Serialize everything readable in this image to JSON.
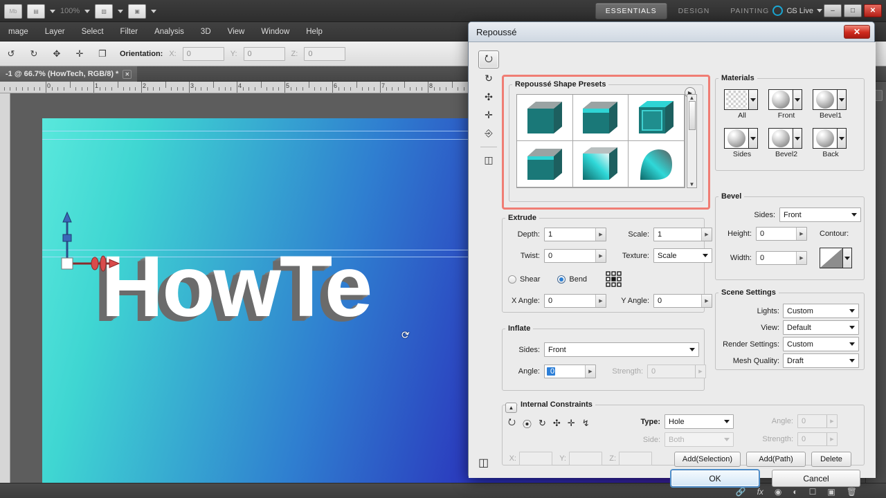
{
  "app": {
    "menus": [
      "mage",
      "Layer",
      "Select",
      "Filter",
      "Analysis",
      "3D",
      "View",
      "Window",
      "Help"
    ],
    "zoom_level": "100%",
    "mb_label": "Mb",
    "workspaces": [
      {
        "label": "ESSENTIALS",
        "active": true
      },
      {
        "label": "DESIGN",
        "active": false
      },
      {
        "label": "PAINTING",
        "active": false
      }
    ],
    "workspace_more": "»",
    "cs_live": "CS Live",
    "window_buttons": {
      "minimize": "–",
      "restore": "□",
      "close": "✕"
    },
    "document_tab": {
      "title": "-1 @ 66.7% (HowTech, RGB/8) *",
      "close": "✕"
    },
    "ruler_numbers": [
      "0",
      "1",
      "2",
      "3",
      "4",
      "5",
      "6",
      "7",
      "8"
    ],
    "canvas_text": "HowTe",
    "cursor_icon": "rotate-3d-cursor"
  },
  "options_bar": {
    "orientation_label": "Orientation:",
    "axes": [
      {
        "label": "X:",
        "value": "0"
      },
      {
        "label": "Y:",
        "value": "0"
      },
      {
        "label": "Z:",
        "value": "0"
      }
    ],
    "mesh_tools": [
      "↺",
      "↻",
      "✥",
      "✛",
      "❐"
    ]
  },
  "dialog": {
    "title": "Repoussé",
    "close_label": "✕",
    "rail_tools": [
      "mesh-rotate-tool",
      "mesh-roll-tool",
      "mesh-drag-tool",
      "mesh-slide-tool",
      "mesh-scale-tool"
    ],
    "rail_extra": "mesh-perspective-tool",
    "presets": {
      "legend": "Repoussé Shape Presets",
      "menu_icon": "▶",
      "scroll_up": "▲",
      "scroll_down": "▼",
      "items": [
        "preset-1",
        "preset-2",
        "preset-3",
        "preset-4",
        "preset-5",
        "preset-6"
      ]
    },
    "extrude": {
      "legend": "Extrude",
      "depth_label": "Depth:",
      "depth_value": "1",
      "scale_label": "Scale:",
      "scale_value": "1",
      "twist_label": "Twist:",
      "twist_value": "0",
      "texture_label": "Texture:",
      "texture_value": "Scale",
      "shear_label": "Shear",
      "shear_selected": false,
      "bend_label": "Bend",
      "bend_selected": true,
      "x_angle_label": "X Angle:",
      "x_angle_value": "0",
      "y_angle_label": "Y Angle:",
      "y_angle_value": "0",
      "anchor_icon": "anchor-point-grid"
    },
    "inflate": {
      "legend": "Inflate",
      "sides_label": "Sides:",
      "sides_value": "Front",
      "angle_label": "Angle:",
      "angle_value": "0",
      "strength_label": "Strength:",
      "strength_value": "0"
    },
    "materials": {
      "legend": "Materials",
      "items": [
        {
          "label": "All",
          "swatch": "checker"
        },
        {
          "label": "Front",
          "swatch": "sphere"
        },
        {
          "label": "Bevel1",
          "swatch": "sphere"
        },
        {
          "label": "Sides",
          "swatch": "sphere"
        },
        {
          "label": "Bevel2",
          "swatch": "sphere"
        },
        {
          "label": "Back",
          "swatch": "sphere"
        }
      ]
    },
    "bevel": {
      "legend": "Bevel",
      "sides_label": "Sides:",
      "sides_value": "Front",
      "height_label": "Height:",
      "height_value": "0",
      "width_label": "Width:",
      "width_value": "0",
      "contour_label": "Contour:"
    },
    "scene": {
      "legend": "Scene Settings",
      "lights_label": "Lights:",
      "lights_value": "Custom",
      "view_label": "View:",
      "view_value": "Default",
      "render_label": "Render Settings:",
      "render_value": "Custom",
      "mesh_label": "Mesh Quality:",
      "mesh_value": "Draft"
    },
    "constraints": {
      "legend": "Internal Constraints",
      "collapse_icon": "▲",
      "tools": [
        "constraint-rotate",
        "constraint-roll",
        "constraint-spin",
        "constraint-drag",
        "constraint-slide",
        "constraint-path"
      ],
      "type_label": "Type:",
      "type_value": "Hole",
      "side_label": "Side:",
      "side_value": "Both",
      "angle_label": "Angle:",
      "angle_value": "0",
      "strength_label": "Strength:",
      "strength_value": "0",
      "x_label": "X:",
      "x_value": "",
      "y_label": "Y:",
      "y_value": "",
      "z_label": "Z:",
      "z_value": "",
      "add_selection_label": "Add(Selection)",
      "add_path_label": "Add(Path)",
      "delete_label": "Delete"
    },
    "footer": {
      "ok_label": "OK",
      "cancel_label": "Cancel",
      "perspective_icon": "perspective-grid-icon"
    }
  }
}
